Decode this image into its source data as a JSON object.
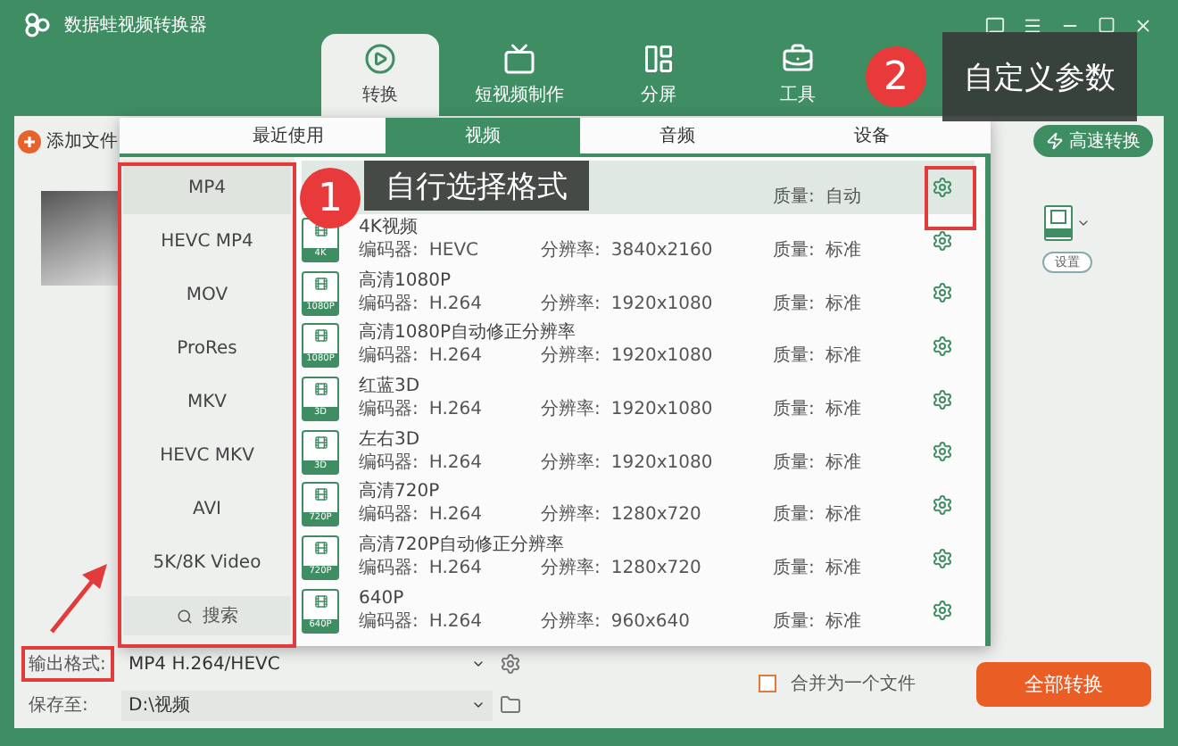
{
  "app": {
    "title": "数据蛙视频转换器"
  },
  "nav_tabs": [
    {
      "label": "转换",
      "selected": true,
      "kind": "convert"
    },
    {
      "label": "短视频制作",
      "selected": false,
      "kind": "short"
    },
    {
      "label": "分屏",
      "selected": false,
      "kind": "split"
    },
    {
      "label": "工具",
      "selected": false,
      "kind": "tools"
    }
  ],
  "toolbar": {
    "add_files": "添加文件",
    "fast_convert": "高速转换"
  },
  "file": {
    "settings": "设置"
  },
  "format_popup": {
    "tabs": [
      {
        "label": "最近使用",
        "selected": false
      },
      {
        "label": "视频",
        "selected": true
      },
      {
        "label": "音频",
        "selected": false
      },
      {
        "label": "设备",
        "selected": false
      }
    ],
    "formats": [
      {
        "label": "MP4",
        "selected": true
      },
      {
        "label": "HEVC MP4",
        "selected": false
      },
      {
        "label": "MOV",
        "selected": false
      },
      {
        "label": "ProRes",
        "selected": false
      },
      {
        "label": "MKV",
        "selected": false
      },
      {
        "label": "HEVC MKV",
        "selected": false
      },
      {
        "label": "AVI",
        "selected": false
      },
      {
        "label": "5K/8K Video",
        "selected": false
      }
    ],
    "search": "搜索",
    "presets": [
      {
        "selected": true,
        "quality_label": "质量:",
        "quality": "自动"
      },
      {
        "selected": false,
        "badge": "4K",
        "name": "4K视频",
        "encoder_label": "编码器:",
        "encoder": "HEVC",
        "resolution_label": "分辨率:",
        "resolution": "3840x2160",
        "quality_label": "质量:",
        "quality": "标准"
      },
      {
        "selected": false,
        "badge": "1080P",
        "name": "高清1080P",
        "encoder_label": "编码器:",
        "encoder": "H.264",
        "resolution_label": "分辨率:",
        "resolution": "1920x1080",
        "quality_label": "质量:",
        "quality": "标准"
      },
      {
        "selected": false,
        "badge": "1080P",
        "name": "高清1080P自动修正分辨率",
        "encoder_label": "编码器:",
        "encoder": "H.264",
        "resolution_label": "分辨率:",
        "resolution": "1920x1080",
        "quality_label": "质量:",
        "quality": "标准"
      },
      {
        "selected": false,
        "badge": "3D",
        "name": "红蓝3D",
        "encoder_label": "编码器:",
        "encoder": "H.264",
        "resolution_label": "分辨率:",
        "resolution": "1920x1080",
        "quality_label": "质量:",
        "quality": "标准"
      },
      {
        "selected": false,
        "badge": "3D",
        "name": "左右3D",
        "encoder_label": "编码器:",
        "encoder": "H.264",
        "resolution_label": "分辨率:",
        "resolution": "1920x1080",
        "quality_label": "质量:",
        "quality": "标准"
      },
      {
        "selected": false,
        "badge": "720P",
        "name": "高清720P",
        "encoder_label": "编码器:",
        "encoder": "H.264",
        "resolution_label": "分辨率:",
        "resolution": "1280x720",
        "quality_label": "质量:",
        "quality": "标准"
      },
      {
        "selected": false,
        "badge": "720P",
        "name": "高清720P自动修正分辨率",
        "encoder_label": "编码器:",
        "encoder": "H.264",
        "resolution_label": "分辨率:",
        "resolution": "1280x720",
        "quality_label": "质量:",
        "quality": "标准"
      },
      {
        "selected": false,
        "badge": "640P",
        "name": "640P",
        "encoder_label": "编码器:",
        "encoder": "H.264",
        "resolution_label": "分辨率:",
        "resolution": "960x640",
        "quality_label": "质量:",
        "quality": "标准"
      }
    ]
  },
  "output": {
    "format_label": "输出格式:",
    "format_value": "MP4 H.264/HEVC",
    "save_label": "保存至:",
    "save_value": "D:\\视频",
    "merge_label": "合并为一个文件",
    "merge_checked": false,
    "convert_all": "全部转换"
  },
  "annotations": [
    {
      "number": "1",
      "text": "自行选择格式"
    },
    {
      "number": "2",
      "text": "自定义参数"
    }
  ]
}
